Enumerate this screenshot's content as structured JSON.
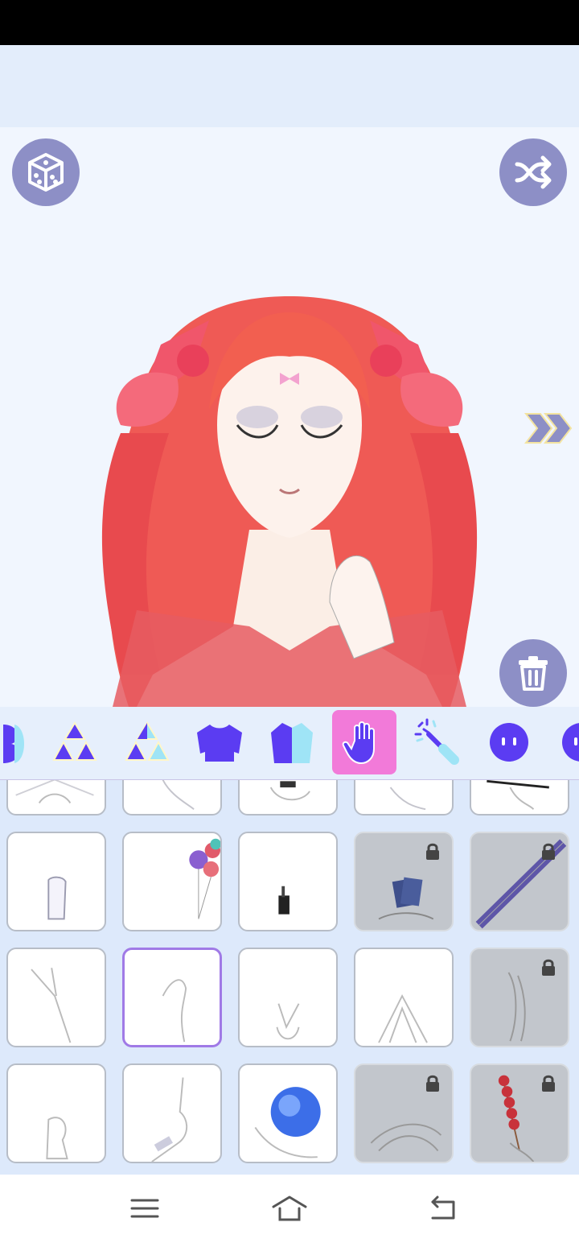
{
  "app": {
    "accent": "#8d8fc6",
    "active_tab_color": "#f27ad9",
    "icon_color": "#5b3cf2"
  },
  "toolbar": {
    "random_icon": "dice-icon",
    "shuffle_icon": "shuffle-icon",
    "next_icon": "double-chevron-right-icon",
    "delete_icon": "trash-icon"
  },
  "categories": [
    {
      "name": "partial-previous",
      "icon": "shape-icon"
    },
    {
      "name": "triangles",
      "icon": "triangles-icon"
    },
    {
      "name": "triangles-alt",
      "icon": "triangles-alt-icon"
    },
    {
      "name": "sweater",
      "icon": "sweater-icon"
    },
    {
      "name": "jacket",
      "icon": "jacket-icon"
    },
    {
      "name": "hand",
      "icon": "hand-icon",
      "active": true
    },
    {
      "name": "wand",
      "icon": "wand-icon"
    },
    {
      "name": "face",
      "icon": "face-icon"
    },
    {
      "name": "face-2",
      "icon": "face-icon"
    }
  ],
  "items": [
    {
      "row": 0,
      "variant": "crossed-arms",
      "locked": false
    },
    {
      "row": 0,
      "variant": "hand-down",
      "locked": false
    },
    {
      "row": 0,
      "variant": "hands-holding",
      "locked": false
    },
    {
      "row": 0,
      "variant": "hand-open",
      "locked": false
    },
    {
      "row": 0,
      "variant": "brush",
      "locked": false
    },
    {
      "row": 1,
      "variant": "gloved-hand",
      "locked": false
    },
    {
      "row": 1,
      "variant": "balloons",
      "locked": false
    },
    {
      "row": 1,
      "variant": "bottle",
      "locked": false
    },
    {
      "row": 1,
      "variant": "cards",
      "locked": true
    },
    {
      "row": 1,
      "variant": "guitar",
      "locked": true
    },
    {
      "row": 2,
      "variant": "peace-hand",
      "locked": false
    },
    {
      "row": 2,
      "variant": "pinch",
      "locked": false,
      "selected": true
    },
    {
      "row": 2,
      "variant": "v-sign",
      "locked": false
    },
    {
      "row": 2,
      "variant": "steeple",
      "locked": false
    },
    {
      "row": 2,
      "variant": "graceful",
      "locked": true
    },
    {
      "row": 3,
      "variant": "fist",
      "locked": false
    },
    {
      "row": 3,
      "variant": "point-up",
      "locked": false
    },
    {
      "row": 3,
      "variant": "orb",
      "locked": false
    },
    {
      "row": 3,
      "variant": "clasped",
      "locked": true
    },
    {
      "row": 3,
      "variant": "candy-skewer",
      "locked": true
    }
  ],
  "navigation": [
    {
      "name": "menu",
      "icon": "menu-icon"
    },
    {
      "name": "home",
      "icon": "home-icon"
    },
    {
      "name": "back",
      "icon": "back-icon"
    }
  ]
}
